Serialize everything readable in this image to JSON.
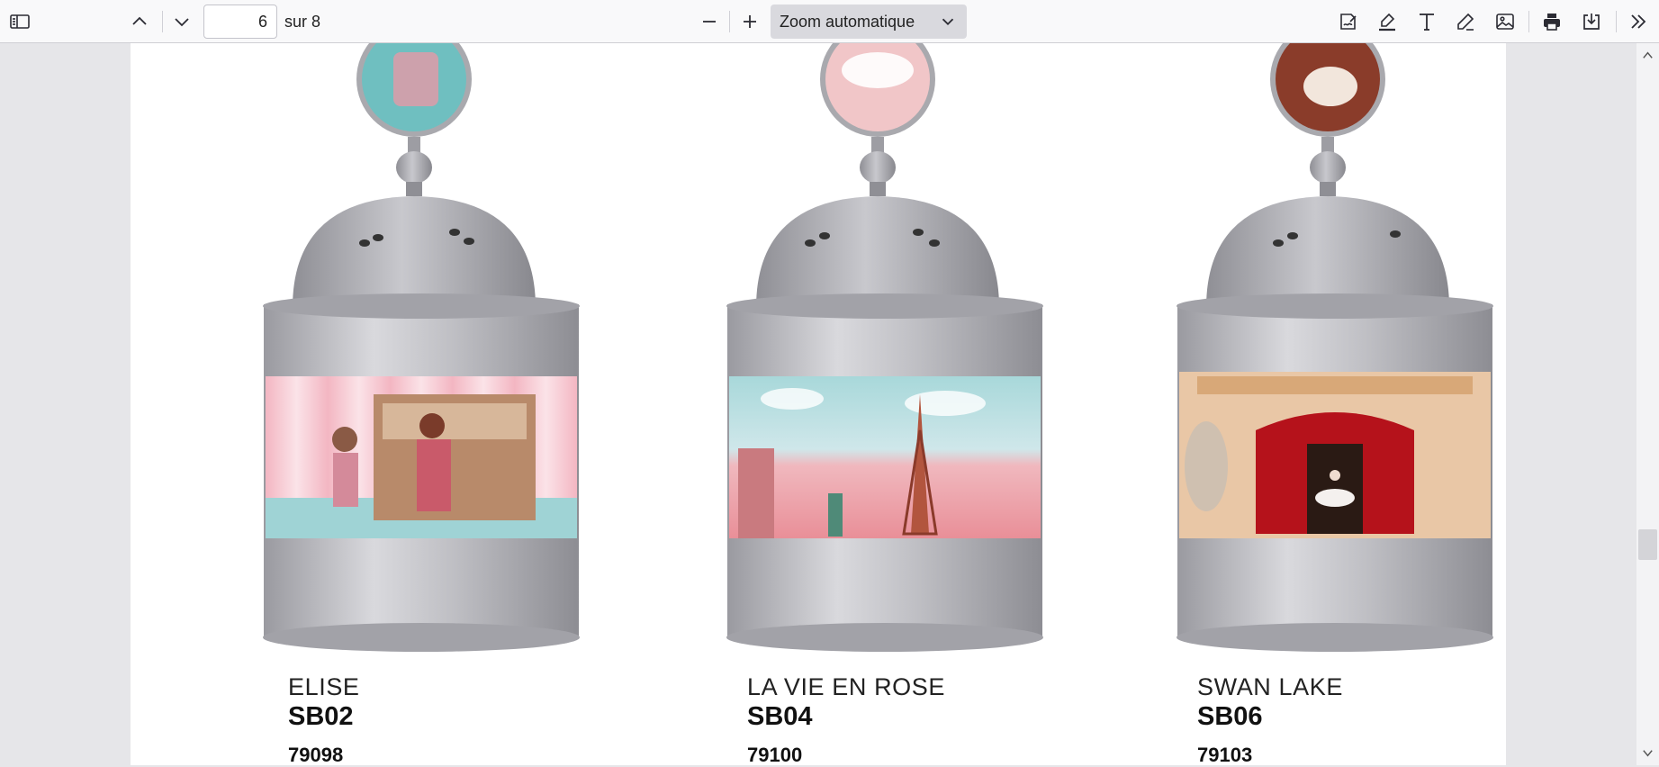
{
  "toolbar": {
    "sidebar_toggle_icon": "sidebar-toggle-icon",
    "prev_page_icon": "chevron-up-icon",
    "next_page_icon": "chevron-down-icon",
    "page_number_value": "6",
    "page_count_text": "sur 8",
    "zoom_out_icon": "minus-icon",
    "zoom_in_icon": "plus-icon",
    "zoom_value": "Zoom automatique",
    "tools": [
      "signature-icon",
      "highlight-icon",
      "text-icon",
      "draw-icon",
      "image-icon",
      "print-icon",
      "save-icon",
      "more-tools-icon"
    ]
  },
  "products": [
    {
      "name": "ELISE",
      "sku": "SB02",
      "code": "79098",
      "theme": "piano"
    },
    {
      "name": "LA VIE EN ROSE",
      "sku": "SB04",
      "code": "79100",
      "theme": "paris"
    },
    {
      "name": "SWAN LAKE",
      "sku": "SB06",
      "code": "79103",
      "theme": "ballet"
    }
  ],
  "colors": {
    "toolbar_bg": "#f9f9fa",
    "viewer_bg": "#e6e6e9",
    "page_bg": "#ffffff",
    "zoom_select_bg": "#d9d9de",
    "tin_silver": "#b8b8bd"
  }
}
